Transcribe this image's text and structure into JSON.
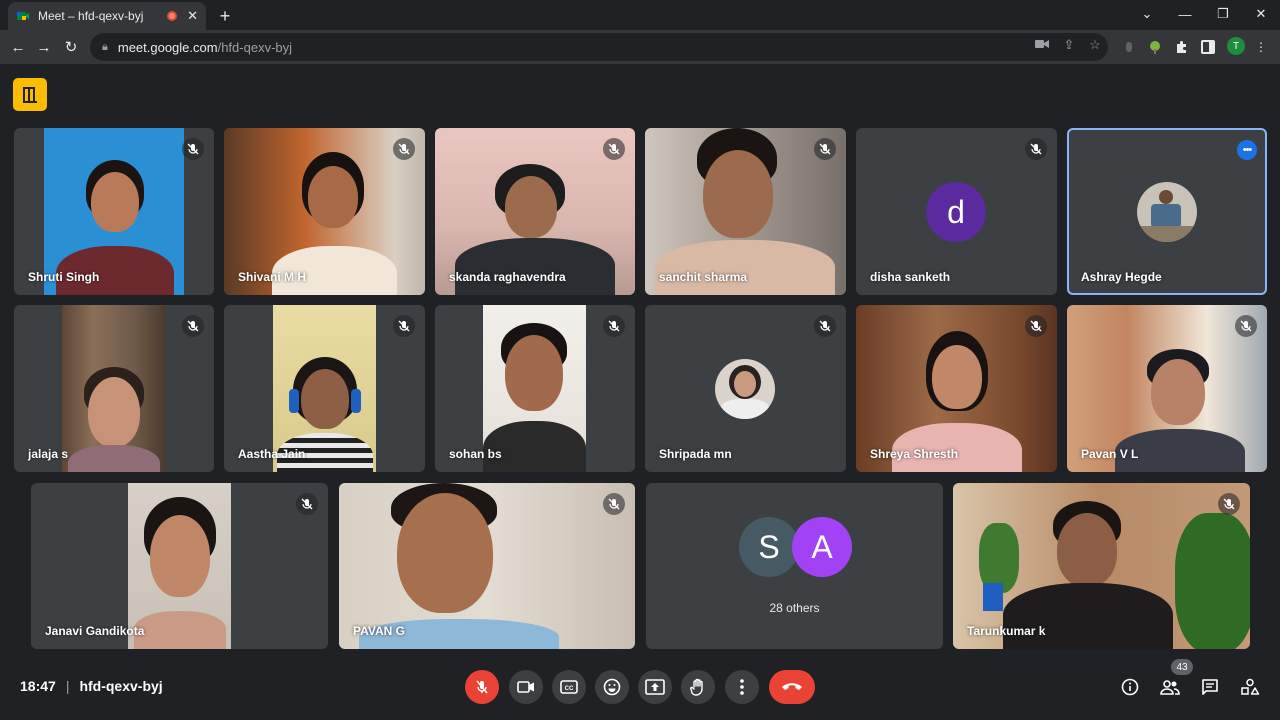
{
  "browser": {
    "tab_title": "Meet – hfd-qexv-byj",
    "url_host": "meet.google.com",
    "url_path": "/hfd-qexv-byj",
    "profile_initial": "T"
  },
  "participants": {
    "row1": [
      "Shruti Singh",
      "Shivani M H",
      "skanda raghavendra",
      "sanchit sharma",
      "disha sanketh",
      "Ashray Hegde"
    ],
    "row2": [
      "jalaja s",
      "Aastha Jain",
      "sohan bs",
      "Shripada mn",
      "Shreya Shresth",
      "Pavan V L"
    ],
    "row3": [
      "Janavi Gandikota",
      "PAVAN G",
      "Tarunkumar k"
    ],
    "disha_initial": "d",
    "others_initials": [
      "S",
      "A"
    ],
    "others_label": "28 others"
  },
  "footer": {
    "time": "18:47",
    "meeting_code": "hfd-qexv-byj",
    "people_count": "43"
  },
  "colors": {
    "end_call": "#ea4335",
    "active_speaker": "#8ab4f8",
    "avatar_d": "#5b2a9e",
    "avatar_s": "#455a64",
    "avatar_a": "#a142f4"
  }
}
